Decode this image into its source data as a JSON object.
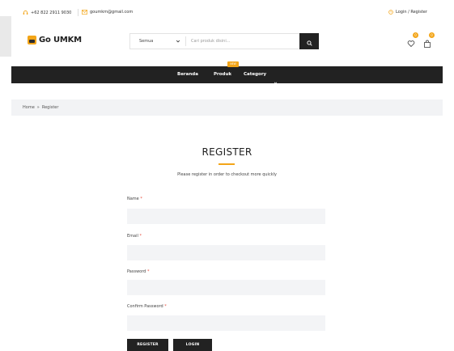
{
  "topbar": {
    "phone": "+62 822 2911 9030",
    "email": "goumkm@gmail.com",
    "login_register": "Login / Register"
  },
  "header": {
    "logo_text": "Go UMKM",
    "search": {
      "category": "Semua",
      "placeholder": "Cari produk disini..."
    },
    "wishlist_count": "0",
    "cart_count": "0"
  },
  "nav": {
    "items": [
      "Beranda",
      "Produk",
      "Category"
    ],
    "new_badge": "NEW"
  },
  "breadcrumb": {
    "home": "Home",
    "separator": "»",
    "current": "Register"
  },
  "register": {
    "title": "REGISTER",
    "subtitle": "Please register in order to checkout more quickly",
    "fields": [
      {
        "label": "Name",
        "required": "*"
      },
      {
        "label": "Email",
        "required": "*"
      },
      {
        "label": "Password",
        "required": "*"
      },
      {
        "label": "Confirm Password",
        "required": "*"
      }
    ],
    "register_button": "REGISTER",
    "login_button": "LOGIN"
  },
  "colors": {
    "accent": "#f3a518",
    "dark": "#222222",
    "required": "#e74c3c"
  }
}
